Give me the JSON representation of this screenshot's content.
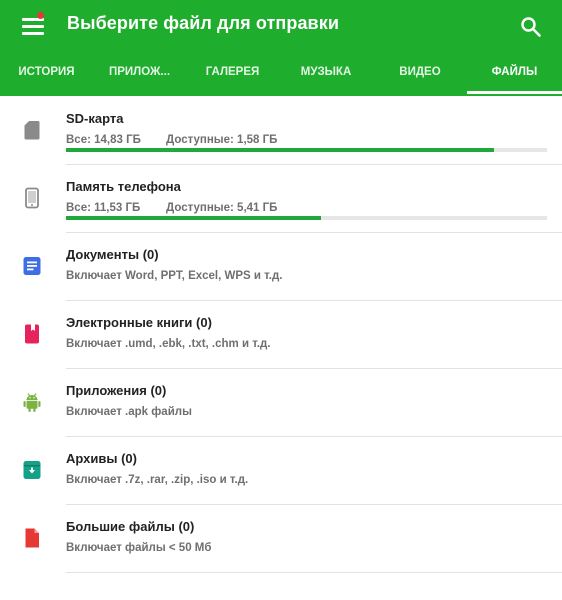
{
  "header": {
    "title": "Выберите файл для отправки",
    "menu_icon": "hamburger-menu-icon",
    "search_icon": "search-icon",
    "accent_color": "#1fad2e"
  },
  "tabs": [
    {
      "label": "ИСТОРИЯ",
      "active": false
    },
    {
      "label": "ПРИЛОЖ...",
      "active": false
    },
    {
      "label": "ГАЛЕРЕЯ",
      "active": false
    },
    {
      "label": "МУЗЫКА",
      "active": false
    },
    {
      "label": "ВИДЕО",
      "active": false
    },
    {
      "label": "ФАЙЛЫ",
      "active": true
    }
  ],
  "storage": [
    {
      "name": "SD-карта",
      "total": "Все: 14,83 ГБ",
      "available": "Доступные: 1,58 ГБ",
      "used_percent": 89,
      "icon": "sd-card-icon"
    },
    {
      "name": "Память телефона",
      "total": "Все: 11,53 ГБ",
      "available": "Доступные: 5,41 ГБ",
      "used_percent": 53,
      "icon": "phone-icon"
    }
  ],
  "categories": [
    {
      "name": "Документы (0)",
      "desc": "Включает Word, PPT, Excel, WPS и т.д.",
      "icon": "document-icon",
      "color": "#3f6de4"
    },
    {
      "name": "Электронные книги (0)",
      "desc": "Включает .umd, .ebk, .txt, .chm и т.д.",
      "icon": "book-icon",
      "color": "#e5245f"
    },
    {
      "name": "Приложения (0)",
      "desc": "Включает .apk файлы",
      "icon": "android-icon",
      "color": "#7cb342"
    },
    {
      "name": "Архивы (0)",
      "desc": "Включает .7z, .rar, .zip, .iso и т.д.",
      "icon": "archive-icon",
      "color": "#15a08a"
    },
    {
      "name": "Большие файлы (0)",
      "desc": "Включает файлы < 50 Мб",
      "icon": "large-file-icon",
      "color": "#e53935"
    }
  ]
}
